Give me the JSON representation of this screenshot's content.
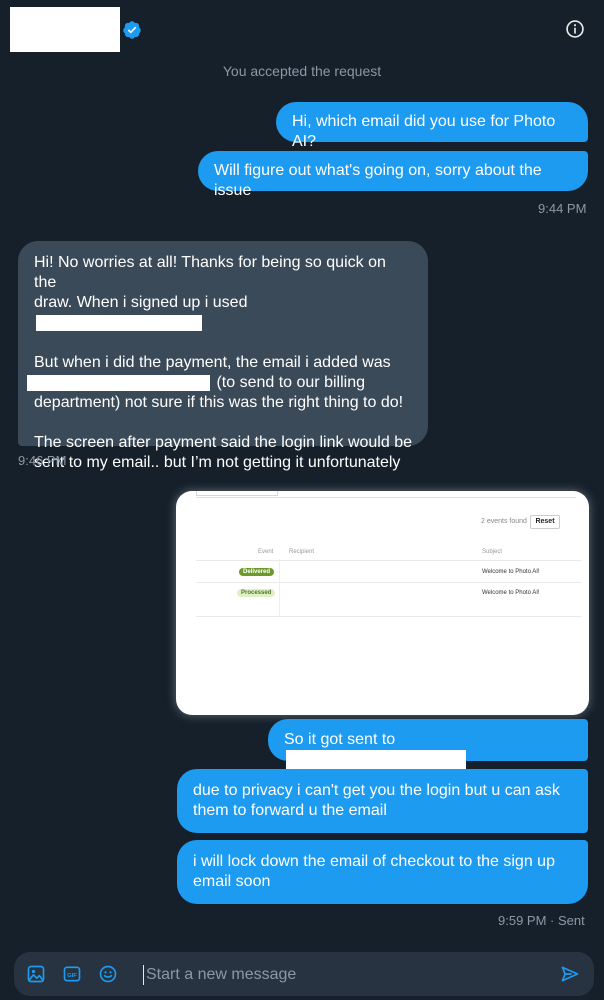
{
  "header": {
    "verified_icon": "verified-badge-icon",
    "info_icon": "info-icon"
  },
  "system_note": "You accepted the request",
  "messages": {
    "m1": "Hi, which email did you use for Photo AI?",
    "m2": "Will figure out what's going on, sorry about the issue",
    "t1": "9:44 PM",
    "m3_line1": "Hi! No worries at all! Thanks for being so quick on the",
    "m3_line2_prefix": "draw. When i signed up i used",
    "m3_p2_line1": "But when i did the payment, the email i added was",
    "m3_p2_line2_suffix": "(to send to our billing",
    "m3_p2_line3": "department) not sure if this was the right thing to do!",
    "m3_p3_line1": "The screen after payment said the login link would be",
    "m3_p3_line2": "sent to my email.. but I’m not getting it unfortunately",
    "t2": "9:46 PM",
    "m4_prefix": "So it got sent to",
    "m5_line1": "due to privacy i can't get you the login but u can ask",
    "m5_line2": "them to forward u the email",
    "m6_line1": "i will lock down the email of checkout to the sign up",
    "m6_line2": "email soon",
    "t3": "9:59 PM · Sent"
  },
  "attachment": {
    "events_found": "2 events found",
    "reset_label": "Reset",
    "col_event": "Event",
    "col_recipient": "Recipient",
    "col_subject": "Subject",
    "rows": [
      {
        "status": "Delivered",
        "subject": "Welcome to Photo AI!"
      },
      {
        "status": "Processed",
        "subject": "Welcome to Photo AI!"
      }
    ]
  },
  "composer": {
    "placeholder": "Start a new message",
    "icons": [
      "image-icon",
      "gif-icon",
      "emoji-icon",
      "send-icon"
    ]
  }
}
